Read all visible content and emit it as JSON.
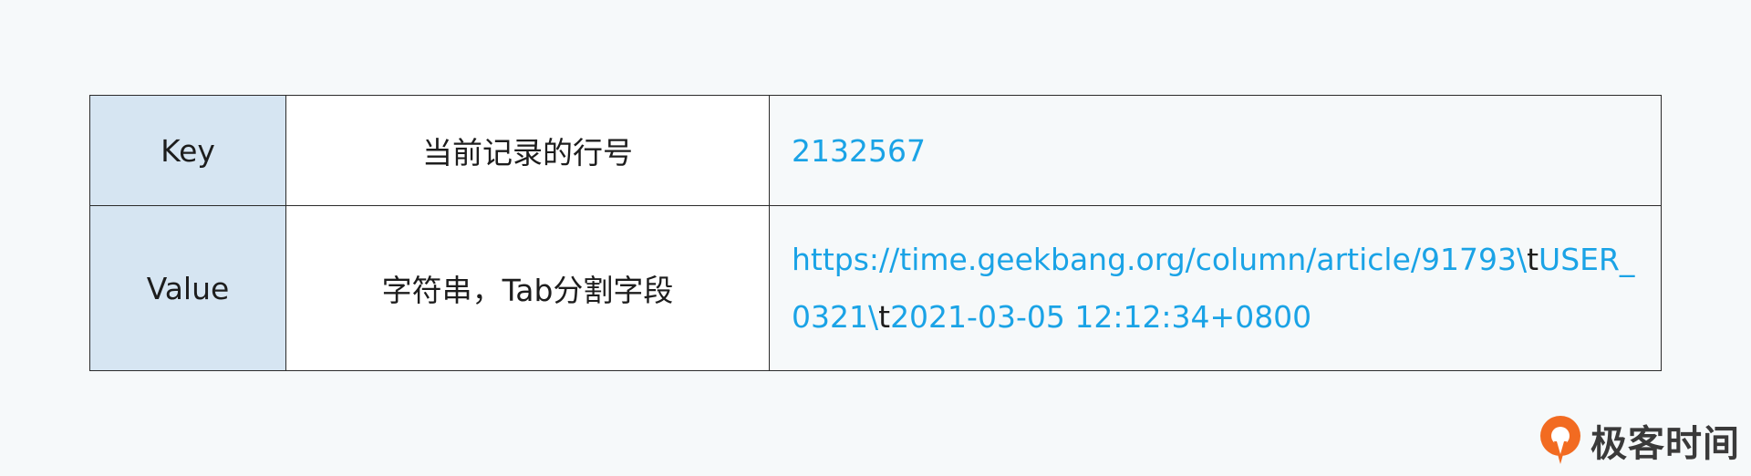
{
  "table": {
    "rows": [
      {
        "label": "Key",
        "description": "当前记录的行号",
        "example": [
          "2132567"
        ]
      },
      {
        "label": "Value",
        "description": "字符串，Tab分割字段",
        "example_parts": [
          "https://time.geekbang.org/column/article/91793\\",
          "t",
          "USER_0321\\",
          "t",
          "2021-03-05 12:12:34+0800"
        ]
      }
    ]
  },
  "brand": {
    "name": "极客时间",
    "logo_icon": "geektime-logo-icon",
    "logo_color": "#f26b21"
  },
  "colors": {
    "key_cell_bg": "#d6e5f2",
    "example_text": "#1aa3e6",
    "border": "#2b2b2b",
    "page_bg": "#f6f9fa"
  }
}
